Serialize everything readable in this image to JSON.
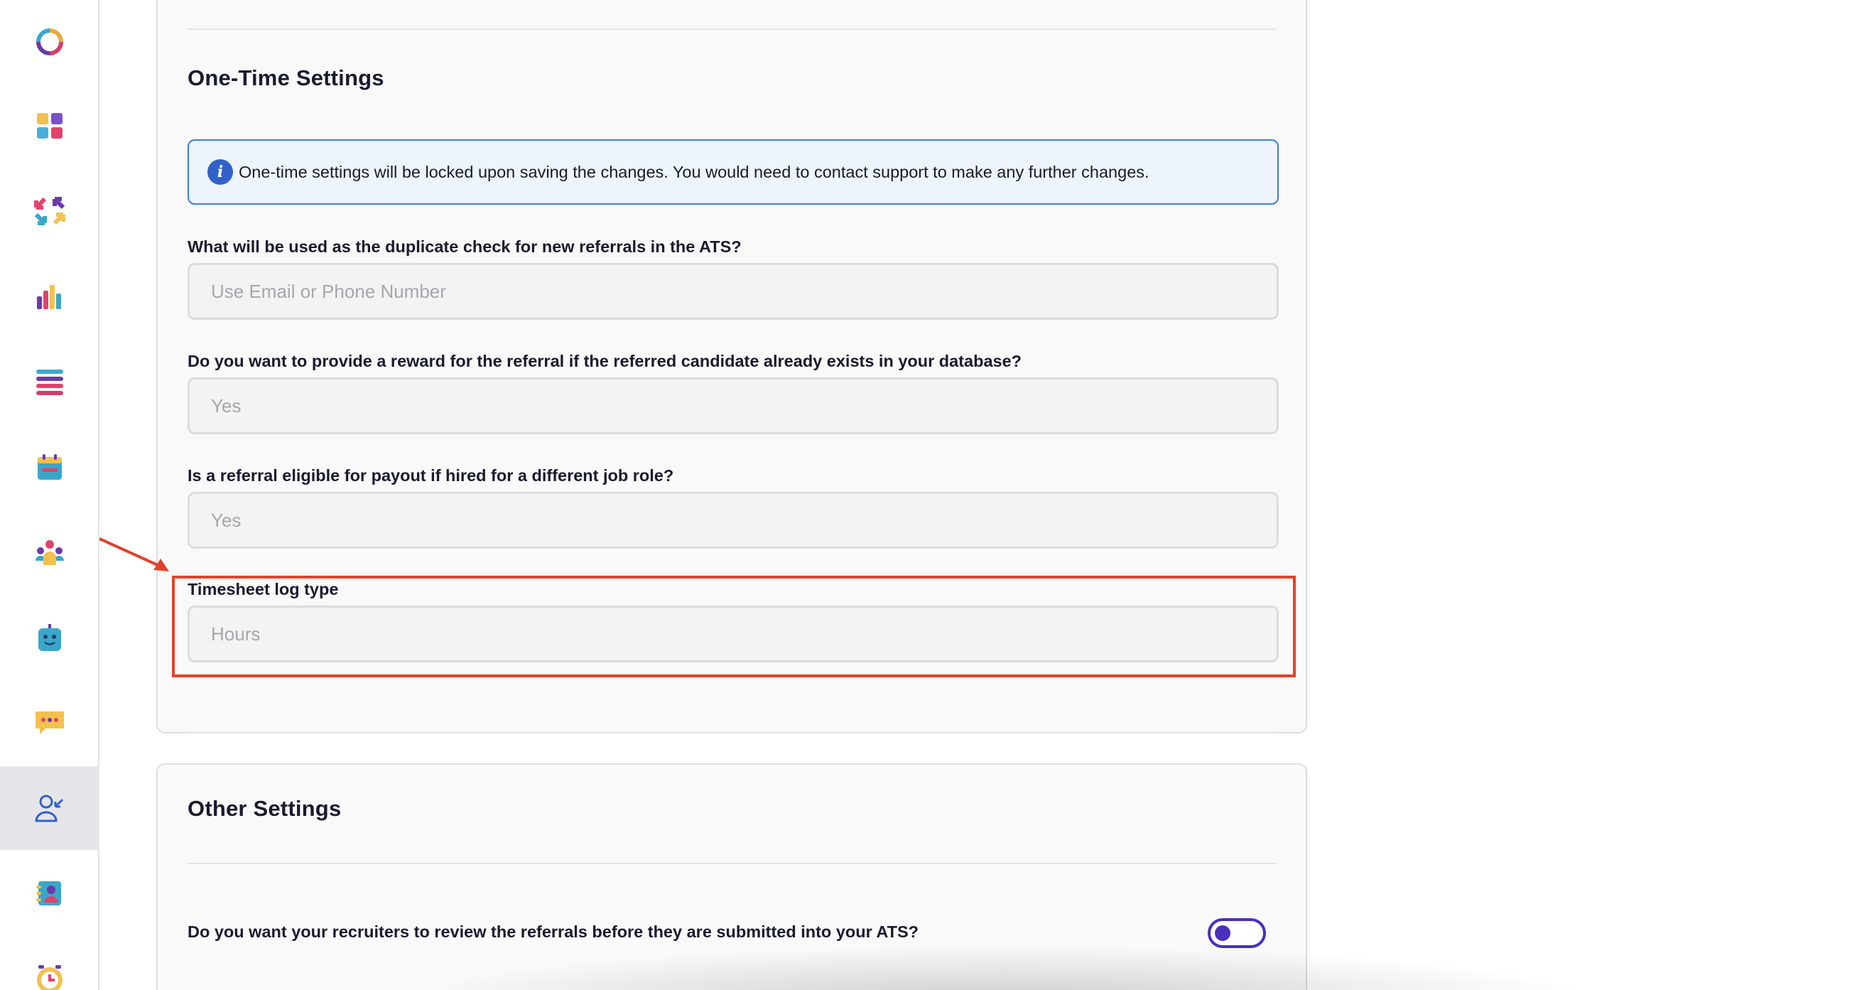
{
  "sidebar": {
    "items": [
      {
        "icon": "logo-ring-icon"
      },
      {
        "icon": "dashboard-grid-icon"
      },
      {
        "icon": "arrows-exchange-icon"
      },
      {
        "icon": "bar-chart-icon"
      },
      {
        "icon": "list-icon"
      },
      {
        "icon": "calendar-icon"
      },
      {
        "icon": "team-icon"
      },
      {
        "icon": "bot-icon"
      },
      {
        "icon": "chat-icon"
      },
      {
        "icon": "user-referral-icon",
        "active": true
      },
      {
        "icon": "contact-card-icon"
      },
      {
        "icon": "clock-icon"
      }
    ]
  },
  "one_time": {
    "title": "One-Time Settings",
    "info": "One-time settings will be locked upon saving the changes. You would need to contact support to make any further changes.",
    "fields": [
      {
        "label": "What will be used as the duplicate check for new referrals in the ATS?",
        "value": "Use Email or Phone Number"
      },
      {
        "label": "Do you want to provide a reward for the referral if the referred candidate already exists in your database?",
        "value": "Yes"
      },
      {
        "label": "Is a referral eligible for payout if hired for a different job role?",
        "value": "Yes"
      },
      {
        "label": "Timesheet log type",
        "value": "Hours"
      }
    ]
  },
  "other": {
    "title": "Other Settings",
    "review_label": "Do you want your recruiters to review the referrals before they are submitted into your ATS?",
    "review_toggle_on": false
  },
  "colors": {
    "accent": "#4b2fbd",
    "info_border": "#3d7be0",
    "highlight": "#e0432b"
  }
}
